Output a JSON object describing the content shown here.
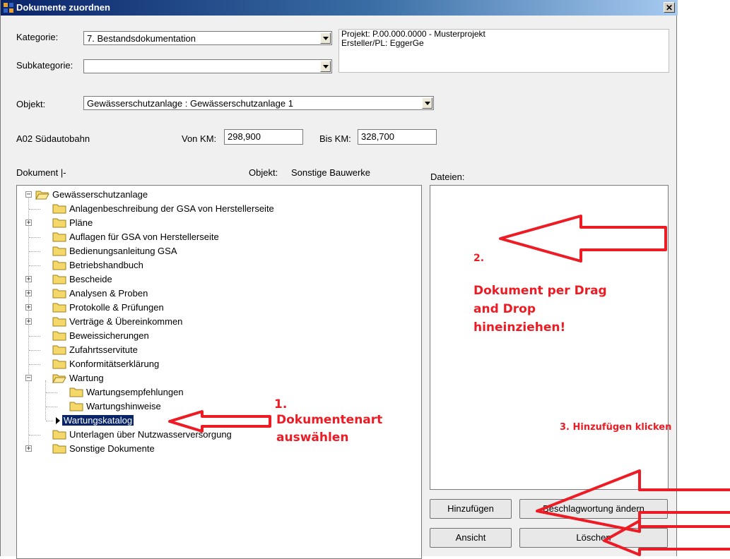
{
  "window": {
    "title": "Dokumente zuordnen",
    "close_glyph": "✕"
  },
  "form": {
    "kategorie_label": "Kategorie:",
    "kategorie_value": "7. Bestandsdokumentation",
    "subkategorie_label": "Subkategorie:",
    "subkategorie_value": "",
    "objekt_label": "Objekt:",
    "objekt_value": "Gewässerschutzanlage : Gewässerschutzanlage 1",
    "road": "A02 Südautobahn",
    "von_km_label": "Von KM:",
    "von_km_value": "298,900",
    "bis_km_label": "Bis KM:",
    "bis_km_value": "328,700"
  },
  "info": {
    "projekt": "Projekt: P.00.000.0000 - Musterprojekt",
    "ersteller": "Ersteller/PL: EggerGe"
  },
  "tree_header": {
    "dokument": "Dokument  |-",
    "objekt_label": "Objekt:",
    "objekt_value": "Sonstige Bauwerke"
  },
  "tree": {
    "root": "Gewässerschutzanlage",
    "items": [
      "Anlagenbeschreibung der GSA von Herstellerseite",
      "Pläne",
      "Auflagen für GSA von Herstellerseite",
      "Bedienungsanleitung GSA",
      "Betriebshandbuch",
      "Bescheide",
      "Analysen & Proben",
      "Protokolle & Prüfungen",
      " Verträge & Übereinkommen",
      "Beweissicherungen",
      "Zufahrtsservitute",
      "Konformitätserklärung",
      "Wartung",
      "Unterlagen über Nutzwasserversorgung",
      "Sonstige Dokumente"
    ],
    "wartung_children": [
      "Wartungsempfehlungen",
      "Wartungshinweise",
      "Wartungskatalog"
    ],
    "selected": "Wartungskatalog"
  },
  "files": {
    "label": "Dateien:"
  },
  "buttons": {
    "hinzufuegen": "Hinzufügen",
    "beschlagwortung": "Beschlagwortung ändern",
    "ansicht": "Ansicht",
    "loeschen": "Löschen"
  },
  "annotations": {
    "step1_number": "1.",
    "step1_line1": "Dokumentenart",
    "step1_line2": "auswählen",
    "step2_number": "2.",
    "step2_line1": "Dokument per Drag",
    "step2_line2": "and Drop",
    "step2_line3": "hineinziehen!",
    "step3": "3. Hinzufügen klicken",
    "color": "#ed1c24"
  }
}
